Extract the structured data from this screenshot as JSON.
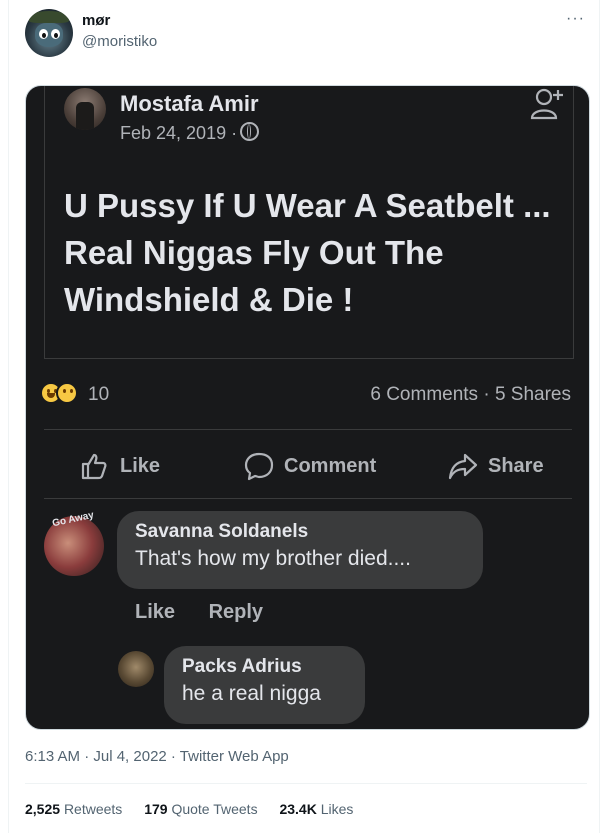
{
  "tweet": {
    "display_name": "mør",
    "handle": "@moristiko",
    "more_label": "···",
    "timestamp": "6:13 AM · Jul 4, 2022 · Twitter Web App"
  },
  "screenshot": {
    "author": "Mostafa Amir",
    "date": "Feb 24, 2019 ·",
    "text": "U Pussy If U Wear A Seatbelt ... Real Niggas Fly Out The Windshield & Die !",
    "reaction_count": "10",
    "stats": "6 Comments · 5 Shares",
    "actions": {
      "like": "Like",
      "comment": "Comment",
      "share": "Share"
    },
    "comments": [
      {
        "avatar_text": "Go Away",
        "name": "Savanna Soldanels",
        "text": "That's how my brother died....",
        "like": "Like",
        "reply": "Reply"
      },
      {
        "name": "Packs Adrius",
        "text": "he a real nigga"
      }
    ]
  },
  "engagement": {
    "retweets_count": "2,525",
    "retweets_label": "Retweets",
    "quotes_count": "179",
    "quotes_label": "Quote Tweets",
    "likes_count": "23.4K",
    "likes_label": "Likes"
  }
}
